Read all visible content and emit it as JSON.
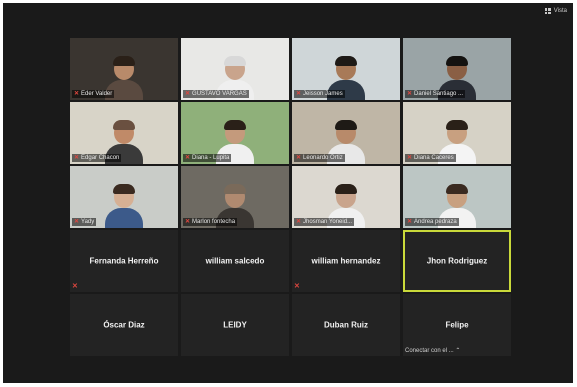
{
  "topbar": {
    "view_label": "Vista"
  },
  "colors": {
    "active_speaker": "#c9d93a",
    "mic_off": "#e0473f",
    "tile_bg": "#232323"
  },
  "video_tiles": [
    {
      "name": "Eder Valder",
      "bg": "#3a3530",
      "skin": "#b88a6a",
      "hair": "#2a2018",
      "shirt": "#5a4a40"
    },
    {
      "name": "GUSTAVO VARGAS",
      "bg": "#e8e8e6",
      "skin": "#c9a48c",
      "hair": "#d8d8d8",
      "shirt": "#efefef"
    },
    {
      "name": "Jeisson James",
      "bg": "#cfd6d8",
      "skin": "#a87a58",
      "hair": "#1e1a16",
      "shirt": "#2e3a48"
    },
    {
      "name": "Daniel Santiago ...",
      "bg": "#9aa4a6",
      "skin": "#8a5f44",
      "hair": "#141210",
      "shirt": "#2a2e36"
    },
    {
      "name": "Edgar Chacon",
      "bg": "#d8d4c8",
      "skin": "#c08a68",
      "hair": "#6a5040",
      "shirt": "#3a3a3a"
    },
    {
      "name": "Diana - Lupita",
      "bg": "#8fb07a",
      "skin": "#c49a7c",
      "hair": "#2a2018",
      "shirt": "#f0f0f0"
    },
    {
      "name": "Leonardo Ortiz",
      "bg": "#bfb6a6",
      "skin": "#b88a6a",
      "hair": "#1e1a16",
      "shirt": "#e8e8e8"
    },
    {
      "name": "Diana Caceres",
      "bg": "#d6d2c6",
      "skin": "#c8a080",
      "hair": "#2a2018",
      "shirt": "#f4f4f4"
    },
    {
      "name": "Yady",
      "bg": "#c9ccc8",
      "skin": "#d6b094",
      "hair": "#3a2a20",
      "shirt": "#3c5a8a"
    },
    {
      "name": "Marlon fontecha",
      "bg": "#6e6a62",
      "skin": "#b08a70",
      "hair": "#7a6a5a",
      "shirt": "#3a3632"
    },
    {
      "name": "Jhosman Yoneid...",
      "bg": "#dcd8d0",
      "skin": "#c9a48c",
      "hair": "#2a2018",
      "shirt": "#f0f0f0"
    },
    {
      "name": "Andrea pedraza",
      "bg": "#bcc6c4",
      "skin": "#c8a080",
      "hair": "#3a2a20",
      "shirt": "#f2f2f2"
    }
  ],
  "audio_tiles": [
    {
      "name": "Fernanda Herreño",
      "mic_off": true,
      "active": false
    },
    {
      "name": "william salcedo",
      "mic_off": false,
      "active": false
    },
    {
      "name": "william hernandez",
      "mic_off": true,
      "active": false
    },
    {
      "name": "Jhon Rodriguez",
      "mic_off": false,
      "active": true
    },
    {
      "name": "Óscar Diaz",
      "mic_off": false,
      "active": false
    },
    {
      "name": "LEIDY",
      "mic_off": false,
      "active": false
    },
    {
      "name": "Duban Ruiz",
      "mic_off": false,
      "active": false
    },
    {
      "name": "Felipe",
      "mic_off": false,
      "active": false,
      "status": "Conectar con el ... ⌃"
    }
  ]
}
